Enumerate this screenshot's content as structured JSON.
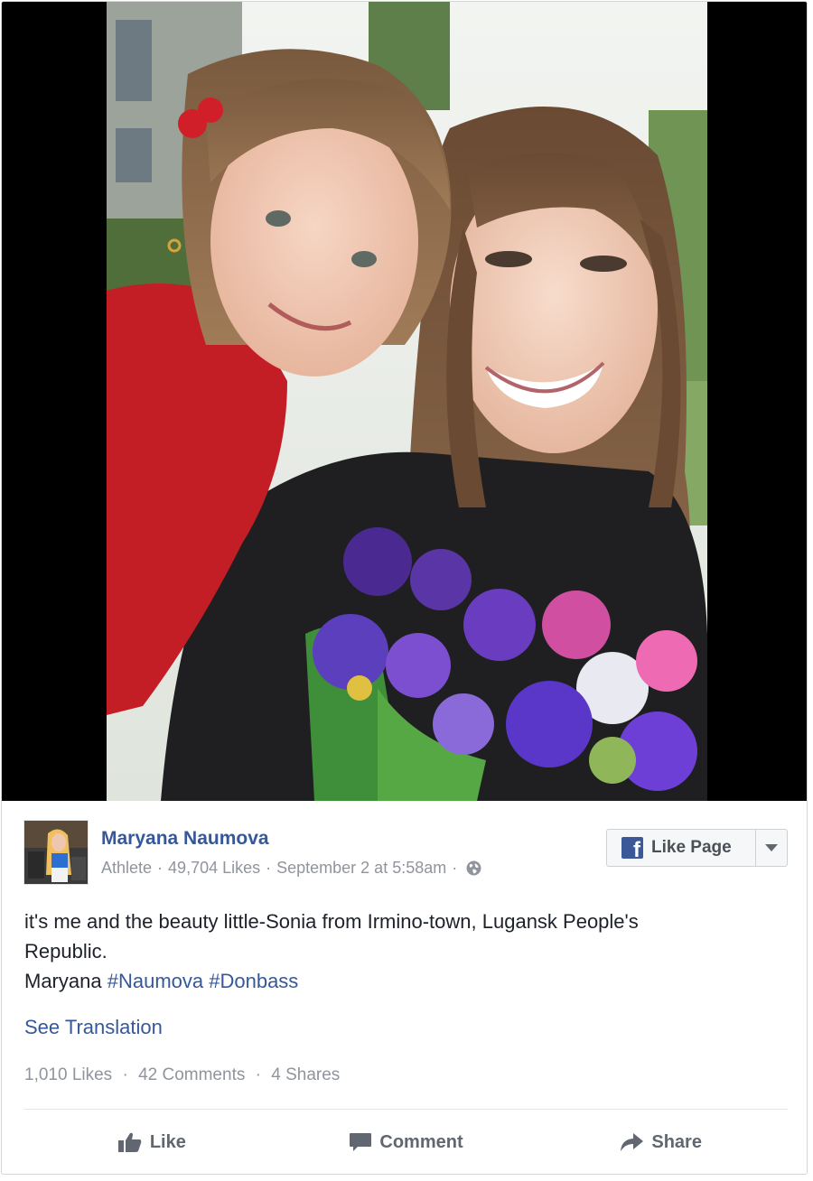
{
  "post": {
    "page_name": "Maryana Naumova",
    "category": "Athlete",
    "page_likes": "49,704 Likes",
    "timestamp": "September 2 at 5:58am",
    "privacy_icon": "globe-icon",
    "like_page_label": "Like Page",
    "text_lines": [
      "it's me and the beauty little-Sonia from Irmino-town, Lugansk People's",
      "Republic."
    ],
    "text_line3_prefix": "Maryana",
    "hashtags": [
      "#Naumova",
      "#Donbass"
    ],
    "see_translation": "See Translation",
    "stats": {
      "likes": "1,010 Likes",
      "comments": "42 Comments",
      "shares": "4 Shares"
    },
    "actions": {
      "like": "Like",
      "comment": "Comment",
      "share": "Share"
    }
  },
  "colors": {
    "link": "#365899",
    "meta": "#90949c",
    "facebook_blue": "#3b5998",
    "action_text": "#606770"
  }
}
